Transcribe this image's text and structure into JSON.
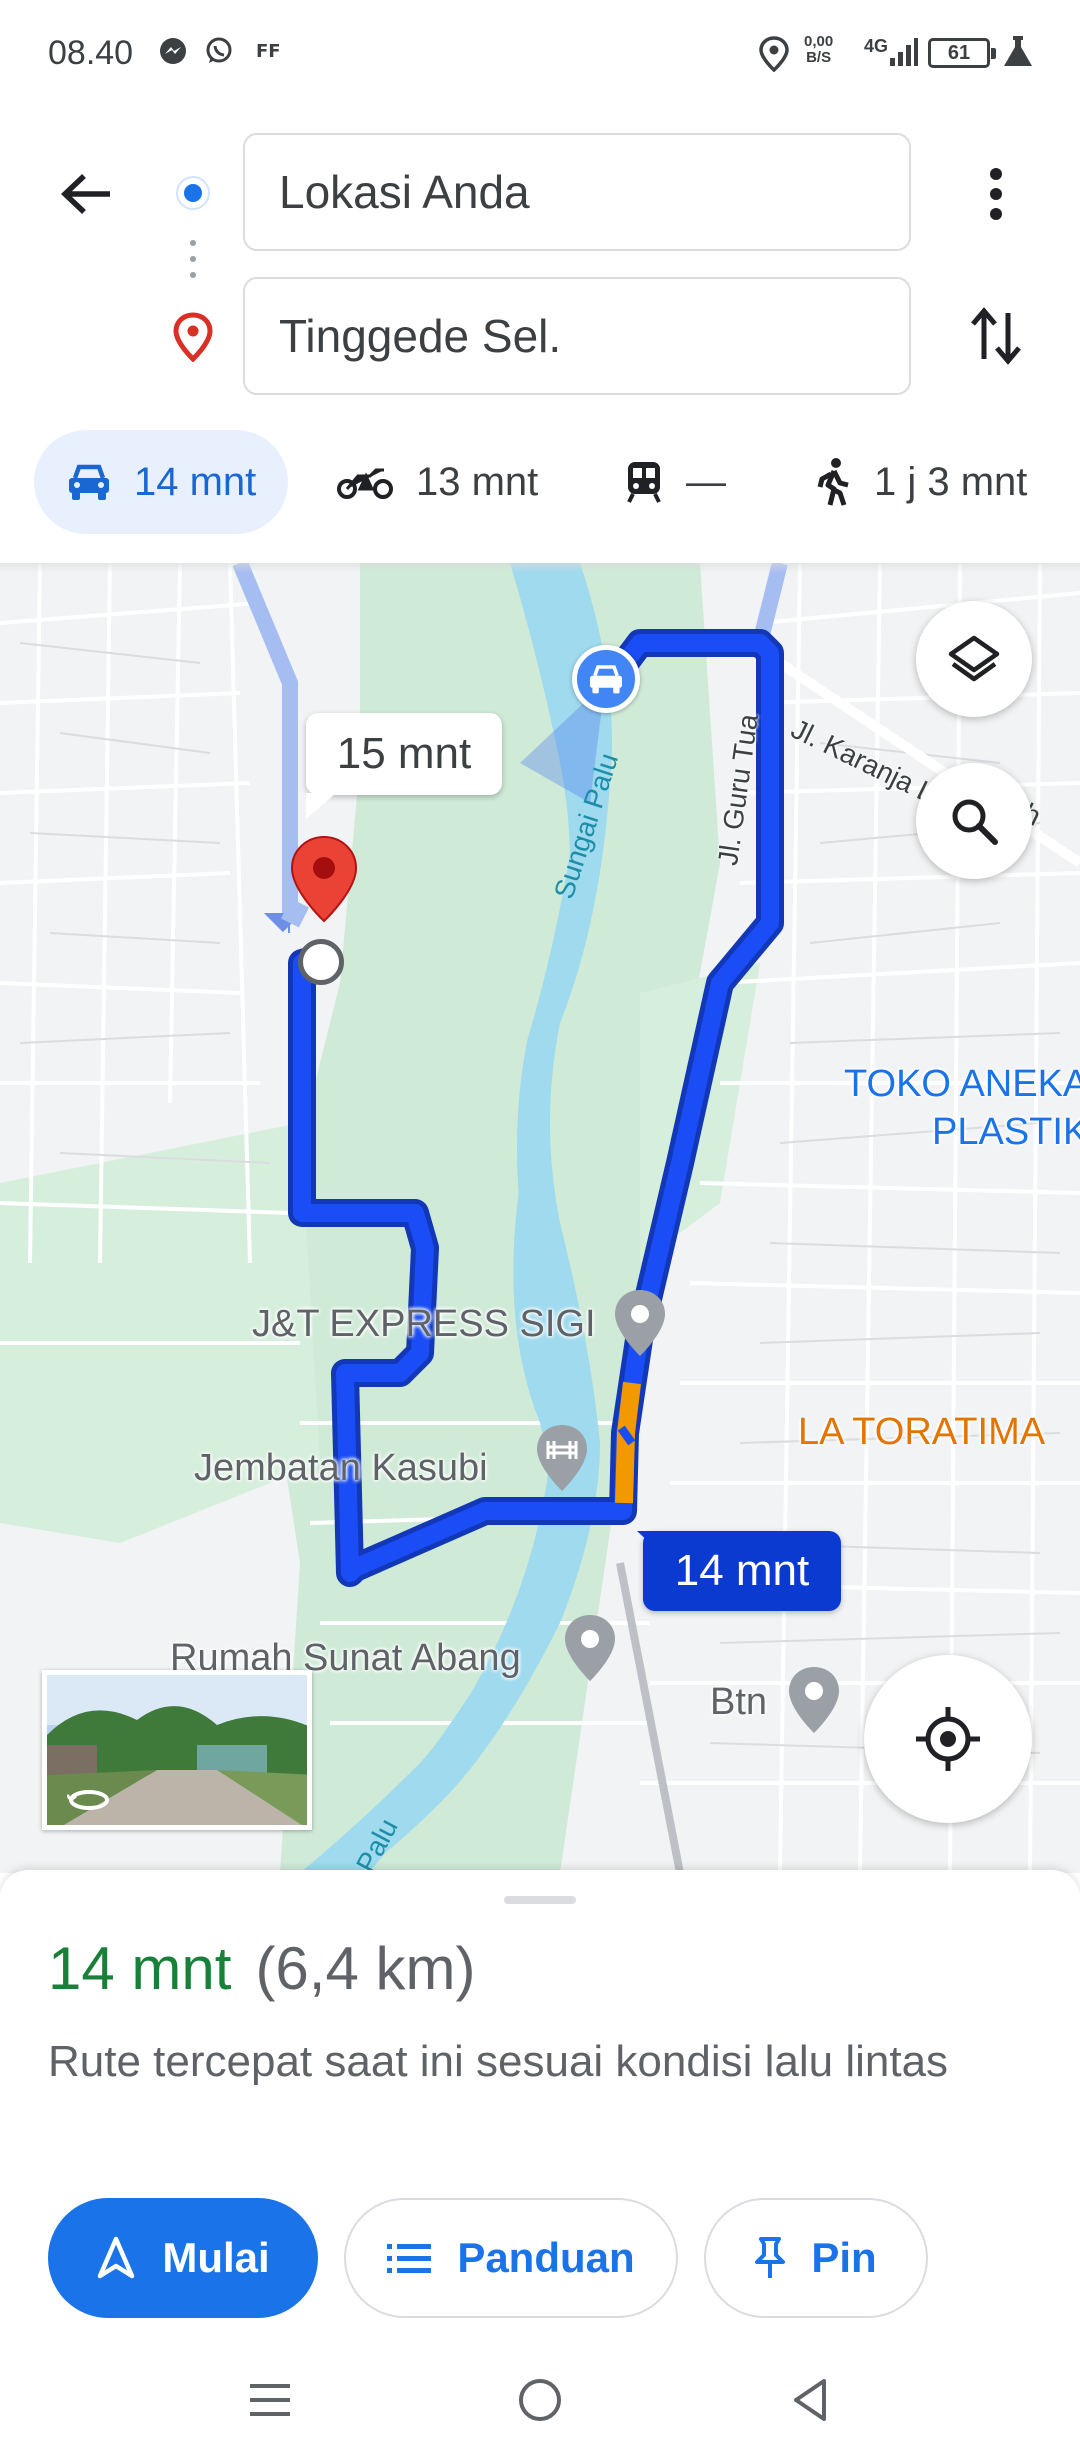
{
  "status_bar": {
    "time": "08.40",
    "net_speed": "0,00\nB/S",
    "net_type": "4G",
    "battery": "61"
  },
  "directions": {
    "origin_value": "Lokasi Anda",
    "destination_value": "Tinggede Sel."
  },
  "modes": [
    {
      "name": "car",
      "label": "14 mnt",
      "selected": true
    },
    {
      "name": "motorcycle",
      "label": "13 mnt",
      "selected": false
    },
    {
      "name": "transit",
      "label": "—",
      "selected": false
    },
    {
      "name": "walk",
      "label": "1 j 3 mnt",
      "selected": false
    }
  ],
  "map": {
    "alt_route_eta": "15 mnt",
    "selected_route_eta": "14 mnt",
    "places": {
      "toko_line1": "TOKO ANEKA",
      "toko_line2": "PLASTIK",
      "jnt": "J&T EXPRESS SIGI",
      "la_toratima": "LA TORATIMA",
      "jembatan": "Jembatan Kasubi",
      "rumah_sunat": "Rumah Sunat Abang",
      "btn": "Btn"
    },
    "roads": {
      "karanja": "Jl. Karanja L",
      "karanja_tail": "h",
      "guru_tua": "Jl. Guru Tua",
      "sungai_palu": "Sungai Palu",
      "palu_bottom": "Palu"
    }
  },
  "summary": {
    "duration": "14 mnt",
    "distance": "(6,4 km)",
    "description": "Rute tercepat saat ini sesuai kondisi lalu lintas"
  },
  "actions": {
    "start": "Mulai",
    "guide": "Panduan",
    "pin": "Pin"
  },
  "colors": {
    "accent": "#1a73e8",
    "route": "#0b3ad1",
    "traffic": "#f29900",
    "duration": "#188038"
  }
}
